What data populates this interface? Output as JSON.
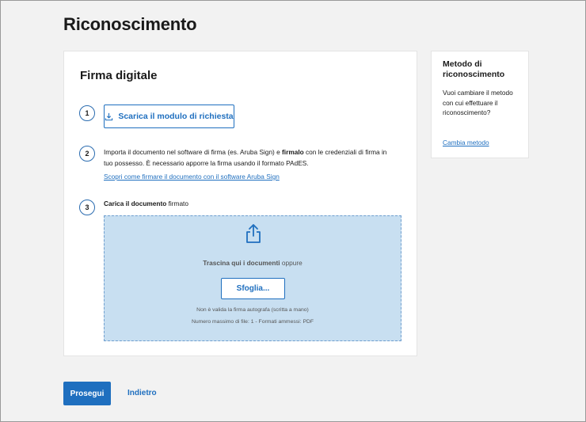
{
  "page": {
    "title": "Riconoscimento"
  },
  "main_card": {
    "title": "Firma digitale",
    "steps": [
      {
        "number": "1",
        "button_label": "Scarica il modulo di richiesta",
        "button_icon": "download-icon"
      },
      {
        "number": "2",
        "text_before": "Importa il documento nel software di firma (es. Aruba Sign) e ",
        "text_bold": "firmalo",
        "text_after": " con le credenziali di firma in tuo possesso. È necessario apporre la firma usando il formato PAdES.",
        "link": "Scopri come firmare il documento con il software Aruba Sign"
      },
      {
        "number": "3",
        "label_bold": "Carica il documento",
        "label_rest": " firmato"
      }
    ],
    "dropzone": {
      "icon": "upload-share-icon",
      "text_bold": "Trascina qui i documenti",
      "text_rest": " oppure",
      "browse_label": "Sfoglia...",
      "note1": "Non è valida la firma autografa (scritta a mano)",
      "note2": "Numero massimo di file: 1 - Formati ammessi: PDF"
    }
  },
  "side_card": {
    "title": "Metodo di riconoscimento",
    "text": "Vuoi cambiare il metodo con cui effettuare il riconoscimento?",
    "link": "Cambia metodo"
  },
  "footer": {
    "proceed_label": "Prosegui",
    "back_label": "Indietro"
  },
  "colors": {
    "accent": "#1f6fbf",
    "dropzone_bg": "#c8dff1"
  }
}
